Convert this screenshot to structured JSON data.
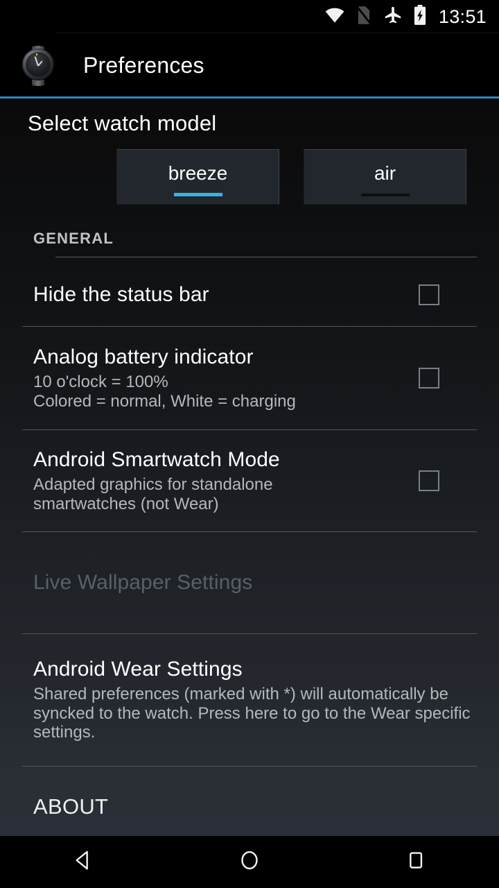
{
  "status_bar": {
    "icons": [
      "wifi-icon",
      "no-sim-icon",
      "airplane-mode-icon",
      "battery-charging-icon"
    ],
    "clock": "13:51"
  },
  "action_bar": {
    "icon": "watch-app-icon",
    "title": "Preferences",
    "accent_color": "#2c88c4"
  },
  "content": {
    "watch_model_header": "Select watch model",
    "tabs": [
      {
        "label": "breeze",
        "selected": true,
        "indicator_color": "#33b5e5"
      },
      {
        "label": "air",
        "selected": false,
        "indicator_color": "#0c0e11"
      }
    ],
    "sections": [
      {
        "header": "GENERAL",
        "items": [
          {
            "title": "Hide the status bar",
            "summary": "",
            "control": "checkbox",
            "checked": false,
            "enabled": true
          },
          {
            "title": "Analog battery indicator",
            "summary": "10 o'clock = 100%\nColored = normal, White = charging",
            "control": "checkbox",
            "checked": false,
            "enabled": true
          },
          {
            "title": "Android Smartwatch Mode",
            "summary": "Adapted graphics for standalone\nsmartwatches (not Wear)",
            "control": "checkbox",
            "checked": false,
            "enabled": true
          },
          {
            "title": "Live Wallpaper Settings",
            "summary": "",
            "control": "none",
            "checked": false,
            "enabled": false
          },
          {
            "title": "Android Wear Settings",
            "summary": "Shared preferences (marked with *) will automatically be syncked to the watch. Press here to go to the Wear specific settings.",
            "control": "none",
            "checked": false,
            "enabled": true
          }
        ]
      },
      {
        "header": "ABOUT",
        "items": []
      }
    ]
  },
  "nav_bar": {
    "buttons": [
      "back-icon",
      "home-icon",
      "recents-icon"
    ]
  }
}
